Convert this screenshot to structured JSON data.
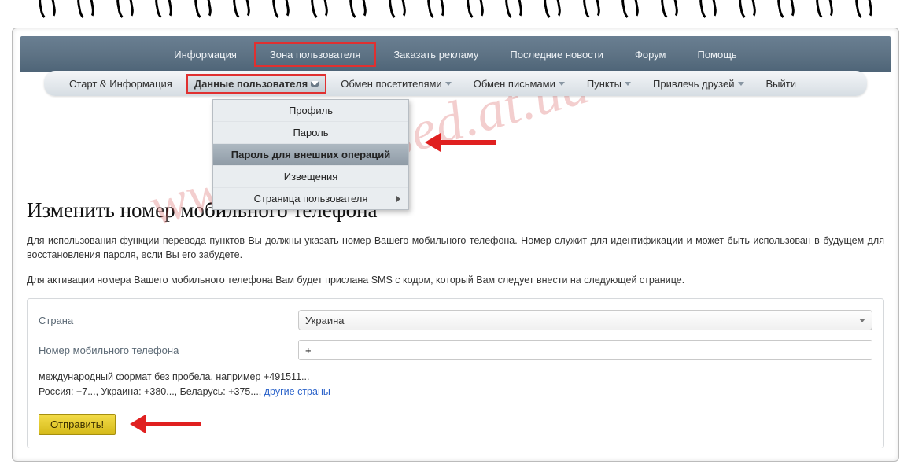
{
  "watermark": "www.domosed.at.ua",
  "topnav": {
    "items": [
      {
        "label": "Информация"
      },
      {
        "label": "Зона пользователя",
        "boxed": true
      },
      {
        "label": "Заказать рекламу"
      },
      {
        "label": "Последние новости"
      },
      {
        "label": "Форум"
      },
      {
        "label": "Помощь"
      }
    ]
  },
  "subnav": {
    "items": [
      {
        "label": "Старт & Информация"
      },
      {
        "label": "Данные пользователя",
        "boxed": true,
        "caret": true
      },
      {
        "label": "Обмен посетителями",
        "caret": true
      },
      {
        "label": "Обмен письмами",
        "caret": true
      },
      {
        "label": "Пункты",
        "caret": true
      },
      {
        "label": "Привлечь друзей",
        "caret": true
      },
      {
        "label": "Выйти"
      }
    ]
  },
  "dropdown": {
    "items": [
      {
        "label": "Профиль"
      },
      {
        "label": "Пароль"
      },
      {
        "label": "Пароль для внешних операций",
        "active": true
      },
      {
        "label": "Извещения"
      },
      {
        "label": "Страница пользователя",
        "sub": true
      }
    ]
  },
  "page": {
    "heading": "Изменить номер мобильного телефона",
    "p1": "Для использования функции перевода пунктов Вы должны указать номер Вашего мобильного телефона. Номер служит для идентификации и может быть использован в будущем для восстановления пароля, если Вы его забудете.",
    "p2": "Для активации номера Вашего мобильного телефона Вам будет прислана SMS с кодом, который Вам следует внести на следующей странице."
  },
  "form": {
    "country_label": "Страна",
    "country_value": "Украина",
    "phone_label": "Номер мобильного телефона",
    "phone_value": "+",
    "hint_line1": "международный формат без пробела, например +491511...",
    "hint_line2_prefix": "Россия: +7..., Украина: +380..., Беларусь: +375..., ",
    "hint_link": "другие страны",
    "submit": "Отправить!"
  }
}
